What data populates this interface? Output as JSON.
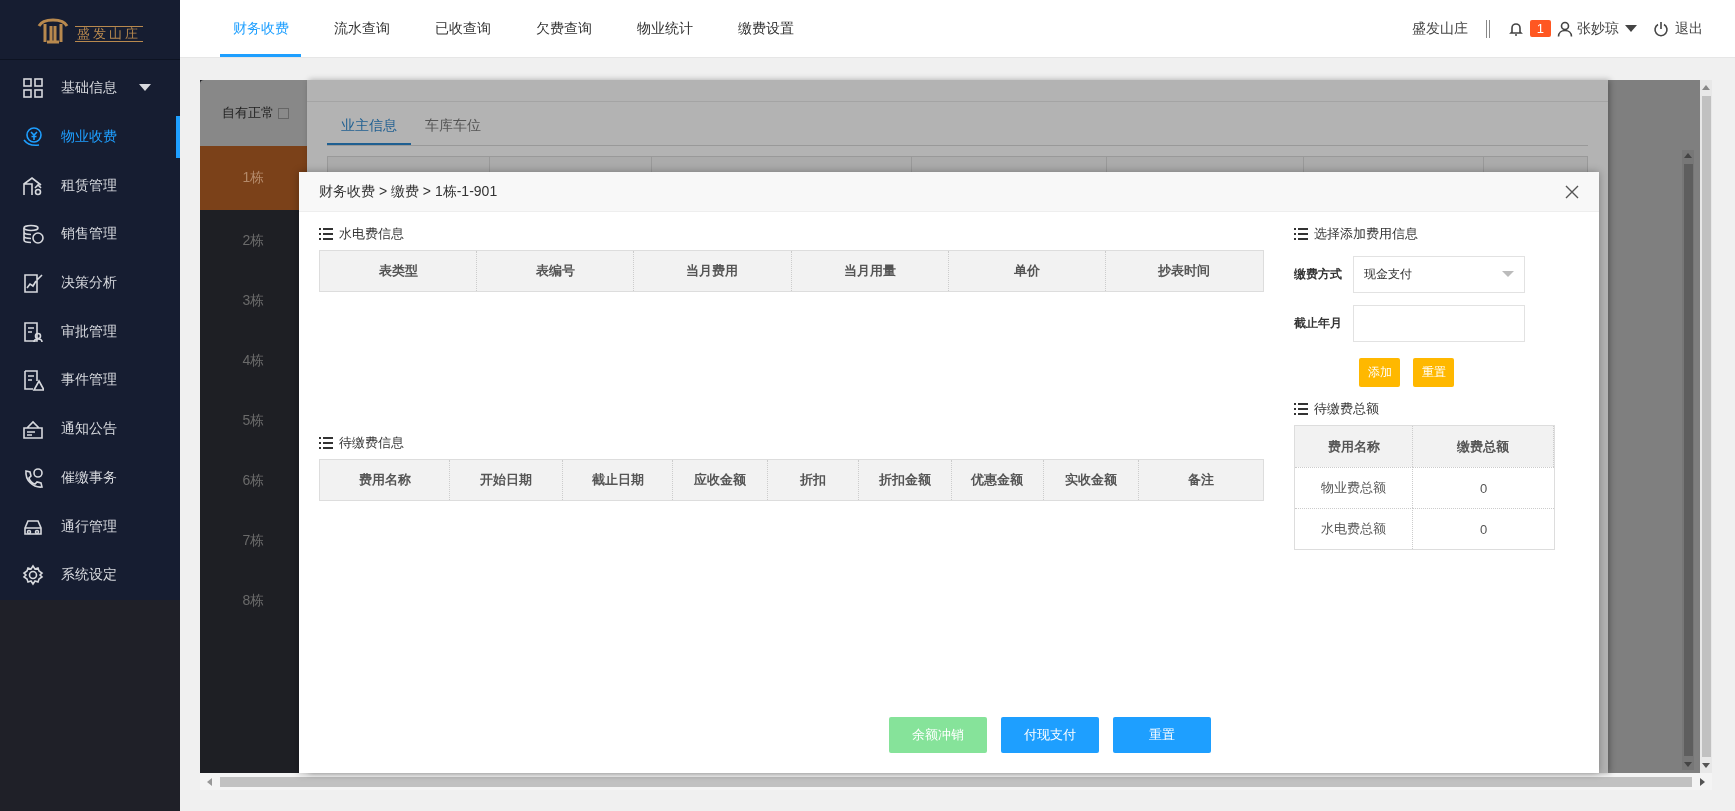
{
  "sidebar": {
    "logo_text": "盛发山庄",
    "items": [
      {
        "label": "基础信息",
        "selected": false,
        "expandable": true
      },
      {
        "label": "物业收费",
        "selected": true,
        "expandable": false
      },
      {
        "label": "租赁管理",
        "selected": false,
        "expandable": false
      },
      {
        "label": "销售管理",
        "selected": false,
        "expandable": false
      },
      {
        "label": "决策分析",
        "selected": false,
        "expandable": false
      },
      {
        "label": "审批管理",
        "selected": false,
        "expandable": false
      },
      {
        "label": "事件管理",
        "selected": false,
        "expandable": false
      },
      {
        "label": "通知公告",
        "selected": false,
        "expandable": false
      },
      {
        "label": "催缴事务",
        "selected": false,
        "expandable": false
      },
      {
        "label": "通行管理",
        "selected": false,
        "expandable": false
      },
      {
        "label": "系统设定",
        "selected": false,
        "expandable": false
      }
    ]
  },
  "top_tabs": [
    {
      "label": "财务收费",
      "selected": true
    },
    {
      "label": "流水查询",
      "selected": false
    },
    {
      "label": "已收查询",
      "selected": false
    },
    {
      "label": "欠费查询",
      "selected": false
    },
    {
      "label": "物业统计",
      "selected": false
    },
    {
      "label": "缴费设置",
      "selected": false
    }
  ],
  "header": {
    "site": "盛发山庄",
    "notifications": "1",
    "user": "张妙琼",
    "logout": "退出"
  },
  "background_page": {
    "filter": {
      "label": "自有正常",
      "checked": false
    },
    "buildings": [
      {
        "label": "1栋",
        "selected": true
      },
      {
        "label": "2栋",
        "selected": false
      },
      {
        "label": "3栋",
        "selected": false
      },
      {
        "label": "4栋",
        "selected": false
      },
      {
        "label": "5栋",
        "selected": false
      },
      {
        "label": "6栋",
        "selected": false
      },
      {
        "label": "7栋",
        "selected": false
      },
      {
        "label": "8栋",
        "selected": false
      }
    ]
  },
  "owner_dialog": {
    "tabs": [
      {
        "label": "业主信息",
        "selected": true
      },
      {
        "label": "车库车位",
        "selected": false
      }
    ]
  },
  "pay_dialog": {
    "breadcrumb": "财务收费 > 缴费 > 1栋-1-901",
    "utility_section": {
      "title": "水电费信息",
      "columns": [
        "表类型",
        "表编号",
        "当月费用",
        "当月用量",
        "单价",
        "抄表时间"
      ]
    },
    "pending_section": {
      "title": "待缴费信息",
      "columns": [
        "费用名称",
        "开始日期",
        "截止日期",
        "应收金额",
        "折扣",
        "折扣金额",
        "优惠金额",
        "实收金额",
        "备注"
      ]
    },
    "add_section": {
      "title": "选择添加费用信息",
      "fields": [
        {
          "kind": "select",
          "label": "缴费方式",
          "value": "现金支付"
        },
        {
          "kind": "input",
          "label": "截止年月"
        }
      ],
      "buttons": [
        "添加",
        "重置"
      ]
    },
    "total_section": {
      "title": "待缴费总额",
      "columns": [
        "费用名称",
        "缴费总额"
      ],
      "rows": [
        [
          "物业费总额",
          "0"
        ],
        [
          "水电费总额",
          "0"
        ]
      ]
    },
    "footer_buttons": [
      {
        "label": "余额冲销",
        "kind": "success"
      },
      {
        "label": "付现支付",
        "kind": "primary"
      },
      {
        "label": "重置",
        "kind": "primary"
      }
    ]
  }
}
